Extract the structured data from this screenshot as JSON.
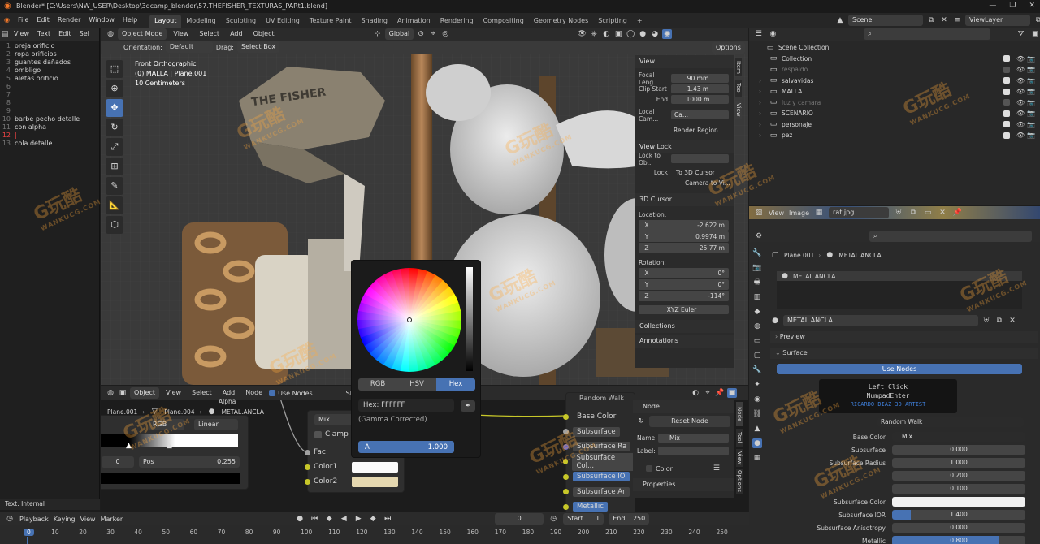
{
  "window": {
    "title": "Blender* [C:\\Users\\NW_USER\\Desktop\\3dcamp_blender\\57.THEFISHER_TEXTURAS_PARt1.blend]",
    "controls": [
      "—",
      "❐",
      "✕"
    ]
  },
  "menubar": {
    "menus": [
      "File",
      "Edit",
      "Render",
      "Window",
      "Help"
    ],
    "workspaces": [
      "Layout",
      "Modeling",
      "Sculpting",
      "UV Editing",
      "Texture Paint",
      "Shading",
      "Animation",
      "Rendering",
      "Compositing",
      "Geometry Nodes",
      "Scripting"
    ],
    "active_workspace": "Layout",
    "add_workspace": "+",
    "scene": "Scene",
    "view_layer": "ViewLayer"
  },
  "text_editor": {
    "menus": [
      "View",
      "Text",
      "Edit",
      "Sel"
    ],
    "lines": [
      {
        "n": "1",
        "t": "oreja orificio"
      },
      {
        "n": "2",
        "t": "ropa orificios"
      },
      {
        "n": "3",
        "t": "guantes dañados"
      },
      {
        "n": "4",
        "t": "ombligo"
      },
      {
        "n": "5",
        "t": "aletas orificio"
      },
      {
        "n": "6",
        "t": ""
      },
      {
        "n": "7",
        "t": ""
      },
      {
        "n": "8",
        "t": ""
      },
      {
        "n": "9",
        "t": ""
      },
      {
        "n": "10",
        "t": "barbe pecho detalle"
      },
      {
        "n": "11",
        "t": "con alpha"
      },
      {
        "n": "12",
        "t": "|"
      },
      {
        "n": "13",
        "t": "cola detalle"
      }
    ],
    "current_line": "12",
    "status": "Text: Internal"
  },
  "viewport": {
    "mode": "Object Mode",
    "menus": [
      "View",
      "Select",
      "Add",
      "Object"
    ],
    "transform": "Global",
    "orientation_label": "Orientation:",
    "orientation": "Default",
    "drag_label": "Drag:",
    "drag": "Select Box",
    "options": "Options",
    "overlay_lines": [
      "Front Orthographic",
      "(0) MALLA | Plane.001",
      "10 Centimeters"
    ],
    "side_tabs": [
      "Item",
      "Tool",
      "View"
    ],
    "sign_text": "THE FISHER"
  },
  "npanel": {
    "view_header": "View",
    "focal_label": "Focal Leng...",
    "focal": "90 mm",
    "clip_start_label": "Clip Start",
    "clip_start": "1.43 m",
    "end_label": "End",
    "end": "1000 m",
    "local_cam_label": "Local Cam...",
    "local_cam": "Ca...",
    "render_region": "Render Region",
    "view_lock_header": "View Lock",
    "lock_to_obj_label": "Lock to Ob...",
    "lock_label": "Lock",
    "to_3d_cursor": "To 3D Cursor",
    "camera_to_view": "Camera to Vi...",
    "cursor_header": "3D Cursor",
    "location_label": "Location:",
    "loc": [
      {
        "a": "X",
        "v": "-2.622 m"
      },
      {
        "a": "Y",
        "v": "0.9974 m"
      },
      {
        "a": "Z",
        "v": "25.77 m"
      }
    ],
    "rotation_label": "Rotation:",
    "rot": [
      {
        "a": "X",
        "v": "0°"
      },
      {
        "a": "Y",
        "v": "0°"
      },
      {
        "a": "Z",
        "v": "-114°"
      }
    ],
    "rotation_mode": "XYZ Euler",
    "collections": "Collections",
    "annotations": "Annotations"
  },
  "outliner": {
    "items": [
      {
        "name": "Scene Collection",
        "indent": 0
      },
      {
        "name": "Collection",
        "indent": 1
      },
      {
        "name": "respaldo",
        "indent": 1,
        "dim": true
      },
      {
        "name": "salvavidas",
        "indent": 1
      },
      {
        "name": "MALLA",
        "indent": 1
      },
      {
        "name": "luz y camara",
        "indent": 1,
        "dim": true
      },
      {
        "name": "SCENARIO",
        "indent": 1
      },
      {
        "name": "personaje",
        "indent": 1
      },
      {
        "name": "pez",
        "indent": 1
      }
    ]
  },
  "image_editor": {
    "menus": [
      "View",
      "Image"
    ],
    "image": "rat.jpg"
  },
  "properties": {
    "breadcrumb_obj": "Plane.001",
    "breadcrumb_mat": "METAL.ANCLA",
    "material_slot": "METAL.ANCLA",
    "material_name": "METAL.ANCLA",
    "preview": "Preview",
    "surface": "Surface",
    "use_nodes": "Use Nodes",
    "tooltip": {
      "l1": "Left Click",
      "l2": "NumpadEnter",
      "l3": "RICARDO DIAZ 3D ARTIST"
    },
    "sss_method": "Random Walk",
    "rows": [
      {
        "label": "Base Color",
        "value": "Mix"
      },
      {
        "label": "Subsurface",
        "value": "0.000"
      },
      {
        "label": "Subsurface Radius",
        "value": "1.000"
      },
      {
        "label": "",
        "value": "0.200"
      },
      {
        "label": "",
        "value": "0.100"
      },
      {
        "label": "Subsurface Color",
        "value": ""
      },
      {
        "label": "Subsurface IOR",
        "value": "1.400"
      },
      {
        "label": "Subsurface Anisotropy",
        "value": "0.000"
      },
      {
        "label": "Metallic",
        "value": "0.800"
      }
    ],
    "ior_fill": 0.14,
    "metallic_fill": 0.8
  },
  "node_editor": {
    "type": "Object",
    "menus": [
      "View",
      "Select",
      "Add",
      "Node"
    ],
    "use_nodes": "Use Nodes",
    "slot": "Slot 1",
    "breadcrumb": [
      "Plane.001",
      "Plane.004",
      "METAL.ANCLA"
    ],
    "ramp_mode": "RGB",
    "ramp_interp": "Linear",
    "ramp_index": "0",
    "pos_label": "Pos",
    "pos_value": "0.255",
    "alpha_label": "Alpha",
    "mix_mode": "Mix",
    "clamp": "Clamp",
    "fac": "Fac",
    "color1": "Color1",
    "color2": "Color2",
    "bsdf_top": "Random Walk",
    "bsdf_sockets": [
      "Base Color",
      "Subsurface",
      "Subsurface Ra",
      "Subsurface Col...",
      "Subsurface IO",
      "Subsurface Ar",
      "Metallic"
    ],
    "side_node_header": "Node",
    "reset_node": "Reset Node",
    "name_label": "Name:",
    "name": "Mix",
    "label_label": "Label:",
    "label": "",
    "color": "Color",
    "properties": "Properties",
    "side_tabs": [
      "Node",
      "Tool",
      "View",
      "Options"
    ]
  },
  "color_picker": {
    "tabs": [
      "RGB",
      "HSV",
      "Hex"
    ],
    "active": "Hex",
    "hex_label": "Hex: FFFFFF",
    "gamma": "(Gamma Corrected)",
    "alpha_label": "A",
    "alpha_value": "1.000"
  },
  "timeline": {
    "menus": [
      "Playback",
      "Keying",
      "View",
      "Marker"
    ],
    "current_frame": "0",
    "start_label": "Start",
    "start": "1",
    "end_label": "End",
    "end": "250",
    "ticks": [
      "0",
      "10",
      "20",
      "30",
      "40",
      "50",
      "60",
      "70",
      "80",
      "90",
      "100",
      "110",
      "120",
      "130",
      "140",
      "150",
      "160",
      "170",
      "180",
      "190",
      "200",
      "210",
      "220",
      "230",
      "240",
      "250"
    ]
  },
  "watermark": {
    "cn": "G玩酷",
    "en": "WANKUCG.COM"
  },
  "colors": {
    "accent": "#4772b3",
    "panel": "#2b2b2b",
    "socket_yellow": "#c7c729",
    "socket_purple": "#6363c7"
  }
}
